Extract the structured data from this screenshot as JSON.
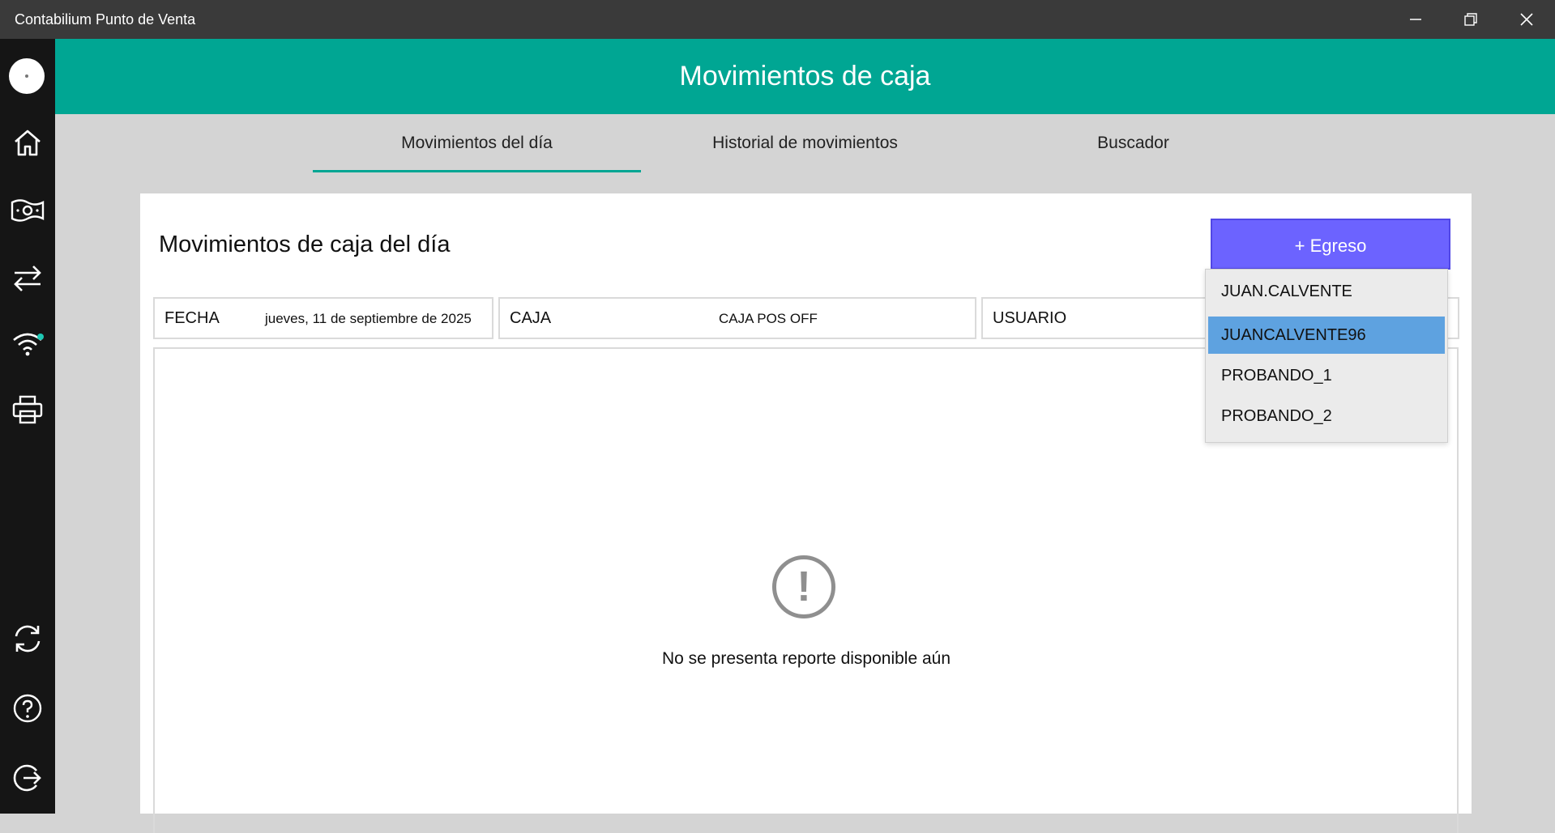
{
  "window": {
    "title": "Contabilium Punto de Venta"
  },
  "header": {
    "title": "Movimientos de caja"
  },
  "tabs": [
    {
      "label": "Movimientos del día",
      "active": true
    },
    {
      "label": "Historial de movimientos",
      "active": false
    },
    {
      "label": "Buscador",
      "active": false
    }
  ],
  "card": {
    "title": "Movimientos de caja del día",
    "egreso_button": "+ Egreso"
  },
  "filters": {
    "fecha": {
      "label": "FECHA",
      "value": "jueves, 11 de septiembre de 2025"
    },
    "caja": {
      "label": "CAJA",
      "value": "CAJA POS OFF"
    },
    "usuario": {
      "label": "USUARIO"
    }
  },
  "user_dropdown": {
    "options": [
      "JUAN.CALVENTE",
      "JUANCALVENTE96",
      "PROBANDO_1",
      "PROBANDO_2"
    ],
    "selected": "JUANCALVENTE96"
  },
  "empty_state": {
    "icon": "exclamation-circle-icon",
    "message": "No se presenta reporte disponible aún"
  },
  "sidebar": {
    "icons": [
      "avatar",
      "home-icon",
      "cash-icon",
      "transfer-icon",
      "wifi-icon",
      "printer-icon",
      "sync-icon",
      "help-icon",
      "logout-icon"
    ],
    "wifi_status_color": "#1ec8b4"
  },
  "colors": {
    "accent": "#00a693",
    "button": "#6c63ff",
    "selected_option": "#5ea2e0"
  }
}
